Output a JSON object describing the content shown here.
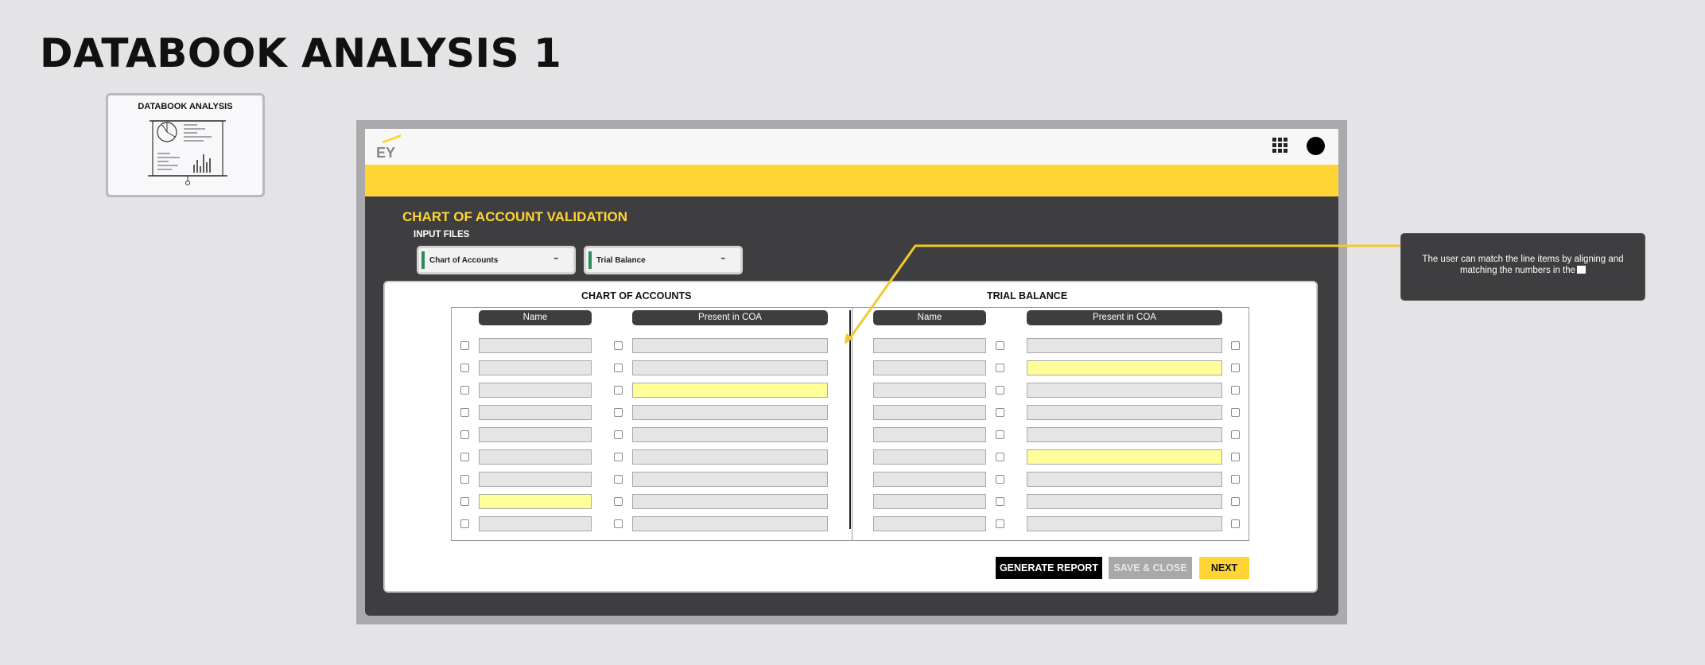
{
  "page": {
    "title": "DATABOOK ANALYSIS 1"
  },
  "thumbnail": {
    "title": "DATABOOK ANALYSIS",
    "icon": "presentation-board-icon"
  },
  "header": {
    "logo": "EY",
    "apps_icon": "grid-icon",
    "avatar_icon": "avatar"
  },
  "validation": {
    "title": "CHART OF ACCOUNT VALIDATION",
    "input_files_label": "INPUT FILES",
    "files": [
      {
        "label": "Chart of Accounts",
        "icon": "file-type-icon"
      },
      {
        "label": "Trial Balance",
        "icon": "file-type-icon"
      }
    ],
    "coa_table": {
      "heading": "CHART OF ACCOUNTS",
      "col_name": "Name",
      "col_present": "Present in COA",
      "highlight_name_rows": [
        8
      ],
      "highlight_present_rows": [
        3
      ]
    },
    "tb_table": {
      "heading": "TRIAL BALANCE",
      "col_name": "Name",
      "col_present": "Present in COA",
      "highlight_name_rows": [],
      "highlight_present_rows": [
        2,
        6
      ]
    },
    "rows": 9
  },
  "buttons": {
    "generate": "GENERATE REPORT",
    "save_close": "SAVE & CLOSE",
    "next": "NEXT"
  },
  "annotation": {
    "text": "The user can match the line items by aligning and matching the numbers in the"
  },
  "colors": {
    "accent_yellow": "#ffd535",
    "highlight": "#ffff9a",
    "panel_dark": "#3e3e40",
    "file_accent": "#2e8b57"
  }
}
